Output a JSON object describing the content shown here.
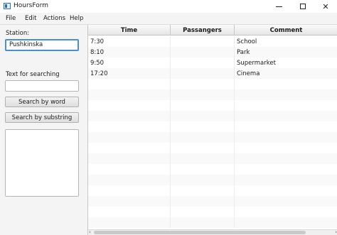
{
  "window": {
    "title": "HoursForm",
    "minimize_symbol": "",
    "maximize_symbol": "",
    "close_symbol": "✕"
  },
  "menu": [
    "File",
    "Edit",
    "Actions",
    "Help"
  ],
  "left_panel": {
    "station_label": "Station:",
    "station_value": "Pushkinska",
    "search_label": "Text for searching",
    "search_value": "",
    "search_by_word": "Search by word",
    "search_by_substring": "Search by substring"
  },
  "table": {
    "columns": [
      "Time",
      "Passangers",
      "Comment"
    ],
    "rows": [
      {
        "time": "7:30",
        "passengers": "",
        "comment": "School"
      },
      {
        "time": "8:10",
        "passengers": "",
        "comment": "Park"
      },
      {
        "time": "9:50",
        "passengers": "",
        "comment": "Supermarket"
      },
      {
        "time": "17:20",
        "passengers": "",
        "comment": "Cinema"
      }
    ],
    "empty_row_count": 14
  },
  "colors": {
    "focus_border": "#4c8fcf",
    "panel_bg": "#f4f4f4"
  }
}
